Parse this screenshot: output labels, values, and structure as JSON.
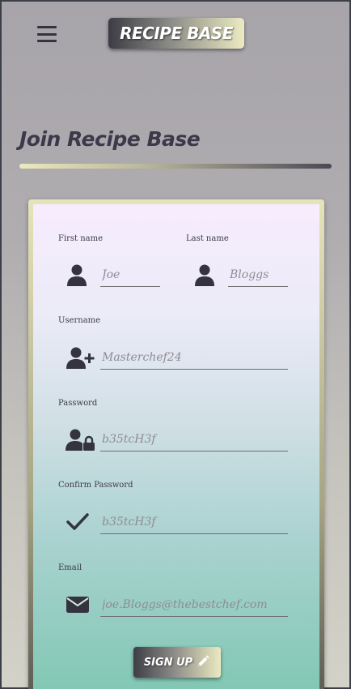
{
  "header": {
    "logo_text": "RECIPE BASE",
    "menu_icon": "hamburger-menu-icon"
  },
  "page": {
    "title": "Join Recipe Base"
  },
  "form": {
    "first_name": {
      "label": "First name",
      "placeholder": "Joe",
      "icon": "user-icon"
    },
    "last_name": {
      "label": "Last name",
      "placeholder": "Bloggs",
      "icon": "user-icon"
    },
    "username": {
      "label": "Username",
      "placeholder": "Masterchef24",
      "icon": "user-plus-icon"
    },
    "password": {
      "label": "Password",
      "placeholder": "b35tcH3f",
      "icon": "user-lock-icon"
    },
    "confirm_password": {
      "label": "Confirm Password",
      "placeholder": "b35tcH3f",
      "icon": "check-icon"
    },
    "email": {
      "label": "Email",
      "placeholder": "joe.Bloggs@thebestchef.com",
      "icon": "envelope-icon"
    },
    "submit_label": "SIGN UP",
    "submit_icon": "pencil-icon"
  },
  "colors": {
    "icon": "#34333f",
    "title": "#3c3a4a",
    "card_top": "#f6ecfd",
    "card_bottom": "#80c7b2"
  }
}
